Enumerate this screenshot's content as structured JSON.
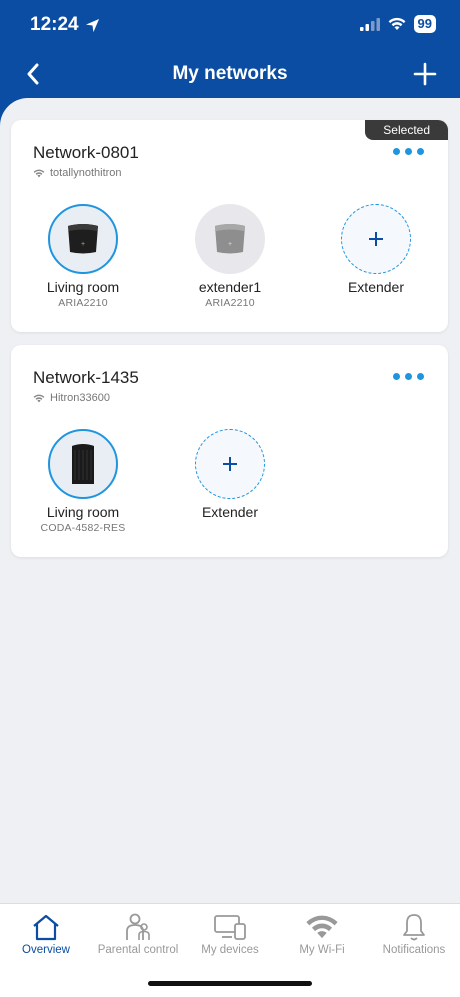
{
  "status": {
    "time": "12:24",
    "battery": "99"
  },
  "header": {
    "title": "My networks"
  },
  "networks": [
    {
      "name": "Network-0801",
      "ssid": "totallynothitron",
      "badge": "Selected",
      "devices": [
        {
          "name": "Living room",
          "model": "ARIA2210"
        },
        {
          "name": "extender1",
          "model": "ARIA2210"
        },
        {
          "name": "Extender",
          "model": ""
        }
      ]
    },
    {
      "name": "Network-1435",
      "ssid": "Hitron33600",
      "devices": [
        {
          "name": "Living room",
          "model": "CODA-4582-RES"
        },
        {
          "name": "Extender",
          "model": ""
        }
      ]
    }
  ],
  "tabs": [
    {
      "label": "Overview",
      "icon": "home-icon"
    },
    {
      "label": "Parental control",
      "icon": "parental-icon"
    },
    {
      "label": "My devices",
      "icon": "devices-icon"
    },
    {
      "label": "My Wi-Fi",
      "icon": "wifi-icon"
    },
    {
      "label": "Notifications",
      "icon": "bell-icon"
    }
  ],
  "colors": {
    "header": "#0a4da2",
    "accent": "#1f95e0",
    "badge": "#3a3a3a"
  }
}
